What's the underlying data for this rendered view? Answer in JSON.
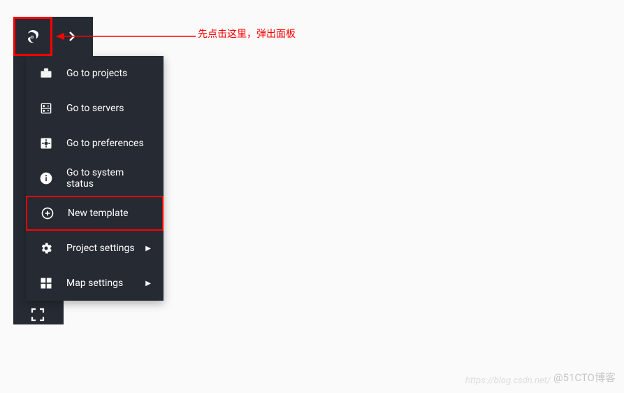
{
  "annotation": {
    "text": "先点击这里，弹出面板"
  },
  "menu": {
    "items": [
      {
        "label": "Go to projects",
        "icon": "briefcase-icon",
        "submenu": false
      },
      {
        "label": "Go to servers",
        "icon": "servers-icon",
        "submenu": false
      },
      {
        "label": "Go to preferences",
        "icon": "gear-box-icon",
        "submenu": false
      },
      {
        "label": "Go to system status",
        "icon": "info-icon",
        "submenu": false
      },
      {
        "label": "New template",
        "icon": "plus-circle-icon",
        "submenu": false,
        "highlighted": true
      },
      {
        "label": "Project settings",
        "icon": "gear-icon",
        "submenu": true
      },
      {
        "label": "Map settings",
        "icon": "grid-icon",
        "submenu": true
      }
    ]
  },
  "watermark": {
    "url": "https://blog.csdn.net/",
    "brand": "@51CTO博客"
  }
}
